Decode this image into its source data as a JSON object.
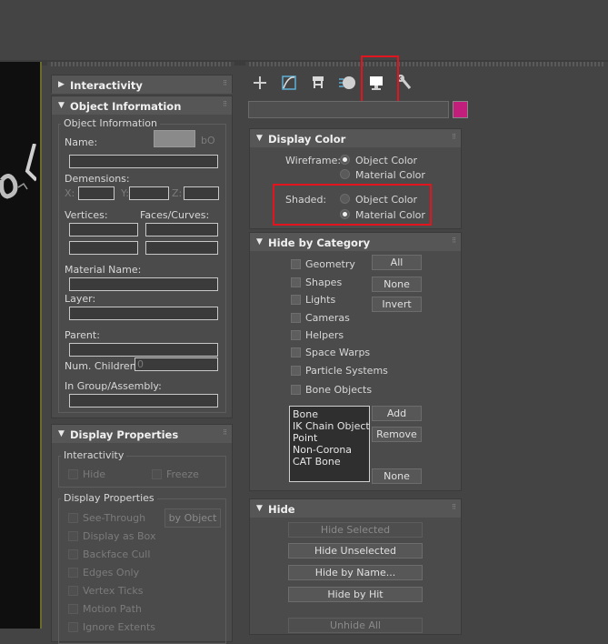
{
  "colors": {
    "accent_swatch": "#c21f7c",
    "highlight": "#e2141e",
    "viewport": "#0f0f0f"
  },
  "command_panel": {
    "tabs": [
      {
        "icon": "plus-icon"
      },
      {
        "icon": "modify-curve-icon"
      },
      {
        "icon": "hierarchy-icon"
      },
      {
        "icon": "motion-icon"
      },
      {
        "icon": "display-monitor-icon",
        "active": true
      },
      {
        "icon": "utilities-wrench-icon"
      }
    ]
  },
  "left": {
    "interactivity_title": "Interactivity",
    "object_info": {
      "title": "Object Information",
      "group_label": "Object Information",
      "name_label": "Name:",
      "color_btn": "bO",
      "dimensions_label": "Demensions:",
      "x_label": "X:",
      "y_label": "Y:",
      "z_label": "Z:",
      "vertices_label": "Vertices:",
      "faces_label": "Faces/Curves:",
      "material_label": "Material Name:",
      "layer_label": "Layer:",
      "parent_label": "Parent:",
      "num_children_label": "Num. Children:",
      "num_children_value": "0",
      "group_assembly_label": "In Group/Assembly:"
    },
    "display_props": {
      "title": "Display Properties",
      "interactivity_group": "Interactivity",
      "hide": "Hide",
      "freeze": "Freeze",
      "display_group": "Display Properties",
      "see_through": "See-Through",
      "by_object": "by Object",
      "display_as_box": "Display as Box",
      "backface_cull": "Backface Cull",
      "edges_only": "Edges Only",
      "vertex_ticks": "Vertex Ticks",
      "motion_path": "Motion Path",
      "ignore_extents": "Ignore Extents"
    }
  },
  "right": {
    "display_color": {
      "title": "Display Color",
      "wireframe_label": "Wireframe:",
      "shaded_label": "Shaded:",
      "object_color": "Object Color",
      "material_color": "Material Color"
    },
    "hide_by_category": {
      "title": "Hide by Category",
      "categories": [
        "Geometry",
        "Shapes",
        "Lights",
        "Cameras",
        "Helpers",
        "Space Warps",
        "Particle Systems",
        "Bone Objects"
      ],
      "all": "All",
      "none": "None",
      "invert": "Invert",
      "list_items": [
        "Bone",
        "IK Chain Object",
        "Point",
        "Non-Corona",
        "CAT Bone"
      ],
      "add": "Add",
      "remove": "Remove",
      "none2": "None"
    },
    "hide": {
      "title": "Hide",
      "hide_selected": "Hide Selected",
      "hide_unselected": "Hide Unselected",
      "hide_by_name": "Hide by Name...",
      "hide_by_hit": "Hide by Hit",
      "unhide_all": "Unhide All"
    }
  }
}
